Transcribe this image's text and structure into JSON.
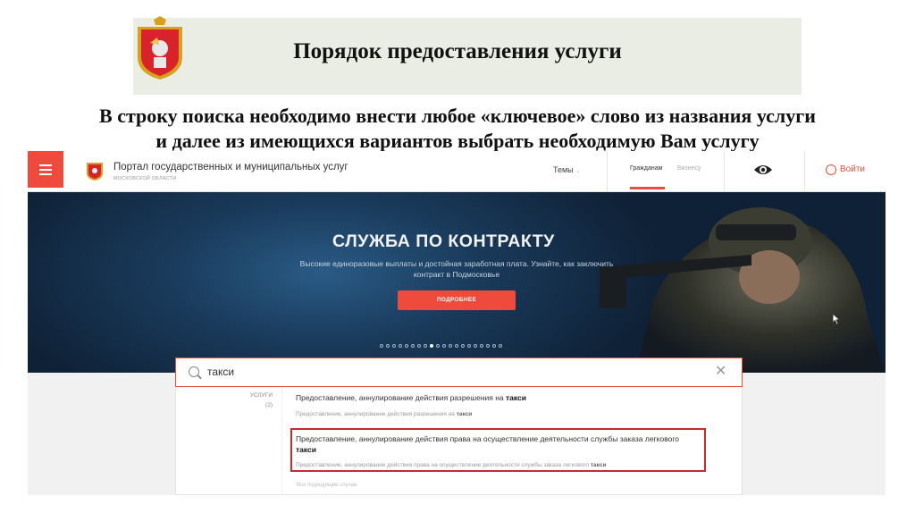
{
  "slide": {
    "title": "Порядок предоставления услуги",
    "instruction_line1": "В строку поиска необходимо внести любое «ключевое» слово из названия услуги",
    "instruction_line2": "и далее из имеющихся вариантов выбрать необходимую Вам услугу"
  },
  "portal": {
    "title": "Портал государственных и муниципальных услуг",
    "subtitle": "МОСКОВСКОЙ ОБЛАСТИ",
    "nav": {
      "themes": "Темы",
      "citizens": "Гражданам",
      "business": "Бизнесу",
      "login": "Войти"
    },
    "accent_color": "#ee4b3c"
  },
  "banner": {
    "title": "СЛУЖБА ПО КОНТРАКТУ",
    "text": "Высокие единоразовые выплаты и достойная заработная плата. Узнайте, как заключить контракт в Подмосковье",
    "button": "ПОДРОБНЕЕ"
  },
  "search": {
    "value": "такси",
    "icon": "search-icon",
    "clear_icon": "close-icon"
  },
  "results": {
    "category_label": "УСЛУГИ",
    "category_count": "(2)",
    "items": [
      {
        "title_prefix": "Предоставление, аннулирование действия разрешения на ",
        "title_keyword": "такси",
        "sub_prefix": "Предоставление, аннулирование действия разрешения на ",
        "sub_keyword": "такси"
      },
      {
        "title_prefix": "Предоставление, аннулирование действия права на осуществление деятельности службы заказа легкового ",
        "title_keyword": "такси",
        "sub_prefix": "Предоставление, аннулирование действия права на осуществление деятельности службы заказа легкового ",
        "sub_keyword": "такси"
      }
    ],
    "all_link": "Все подходящие случаи"
  }
}
